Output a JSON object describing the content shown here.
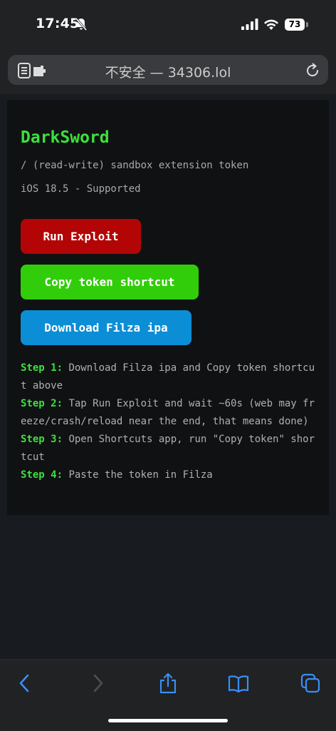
{
  "status_bar": {
    "time": "17:45",
    "battery": "73"
  },
  "browser": {
    "url_text": "不安全 — 34306.lol"
  },
  "page": {
    "title": "DarkSword",
    "subtitle": "/ (read-write) sandbox extension token",
    "support": "iOS 18.5 - Supported",
    "buttons": {
      "run": "Run Exploit",
      "copy": "Copy token shortcut",
      "download": "Download Filza ipa"
    },
    "steps": [
      {
        "label": "Step 1:",
        "text": " Download Filza ipa and Copy token shortcut above"
      },
      {
        "label": "Step 2:",
        "text": " Tap Run Exploit and wait ~60s (web may freeze/crash/reload near the end, that means done)"
      },
      {
        "label": "Step 3:",
        "text": " Open Shortcuts app, run \"Copy token\" shortcut"
      },
      {
        "label": "Step 4:",
        "text": " Paste the token in Filza"
      }
    ]
  },
  "colors": {
    "accent_green": "#3be23b",
    "run_red": "#b30505",
    "copy_green": "#32cd0a",
    "download_blue": "#0b8ed6",
    "toolbar_blue": "#3a8ef6"
  },
  "icons": [
    "bell-slash-icon",
    "signal-icon",
    "wifi-icon",
    "battery-icon",
    "reader-mode-icon",
    "reload-icon",
    "back-icon",
    "forward-icon",
    "share-icon",
    "bookmarks-icon",
    "tabs-icon"
  ]
}
